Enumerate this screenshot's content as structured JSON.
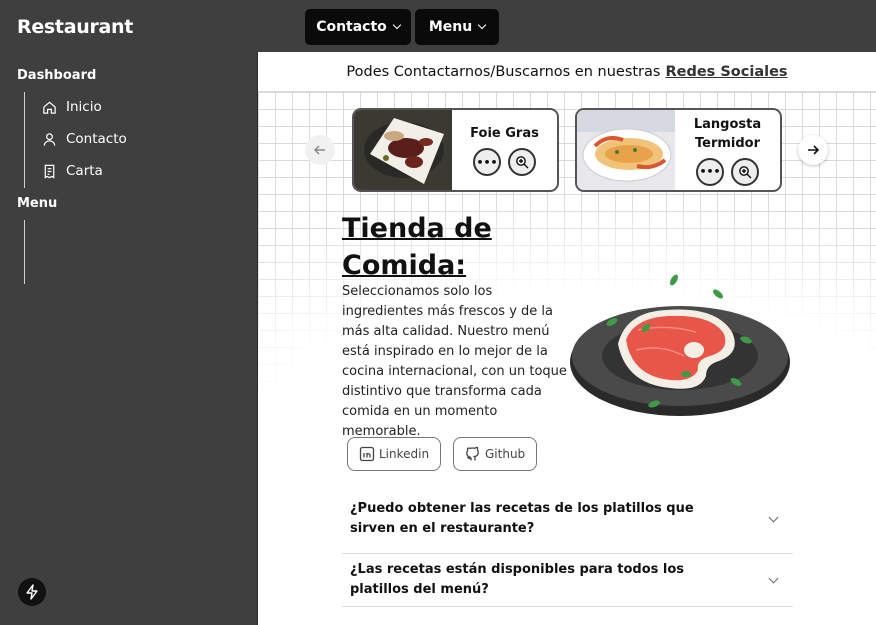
{
  "app": {
    "brand": "Restaurant"
  },
  "topnav": [
    {
      "label": "Contacto"
    },
    {
      "label": "Menu"
    }
  ],
  "sidebar": {
    "sections": [
      {
        "title": "Dashboard",
        "items": [
          {
            "label": "Inicio",
            "icon": "home-icon"
          },
          {
            "label": "Contacto",
            "icon": "user-icon"
          },
          {
            "label": "Carta",
            "icon": "receipt-icon"
          }
        ]
      },
      {
        "title": "Menu",
        "items": []
      }
    ]
  },
  "banner": {
    "text": "Podes Contactarnos/Buscarnos en nuestras",
    "link": "Redes Sociales"
  },
  "carousel": {
    "items": [
      {
        "name": "Foie Gras",
        "more_icon": "more-icon",
        "zoom_icon": "zoom-in-icon"
      },
      {
        "name": "Langosta Termidor",
        "more_icon": "more-icon",
        "zoom_icon": "zoom-in-icon"
      }
    ],
    "prev_icon": "arrow-left-icon",
    "next_icon": "arrow-right-icon"
  },
  "hero": {
    "title_line1": "Tienda de",
    "title_line2": "Comida:",
    "description": "Seleccionamos solo los ingredientes más frescos y de la más alta calidad. Nuestro menú está inspirado en lo mejor de la cocina internacional, con un toque distintivo que transforma cada comida en un momento memorable."
  },
  "social": [
    {
      "label": "Linkedin",
      "icon": "linkedin-icon"
    },
    {
      "label": "Github",
      "icon": "github-icon"
    }
  ],
  "faq": [
    {
      "question": "¿Puedo obtener las recetas de los platillos que sirven en el restaurante?"
    },
    {
      "question": "¿Las recetas están disponibles para todos los platillos del menú?"
    }
  ],
  "colors": {
    "sidebar_bg": "#3f3f3f",
    "button_bg": "#0a0a0a",
    "steak": "#e8564a"
  }
}
